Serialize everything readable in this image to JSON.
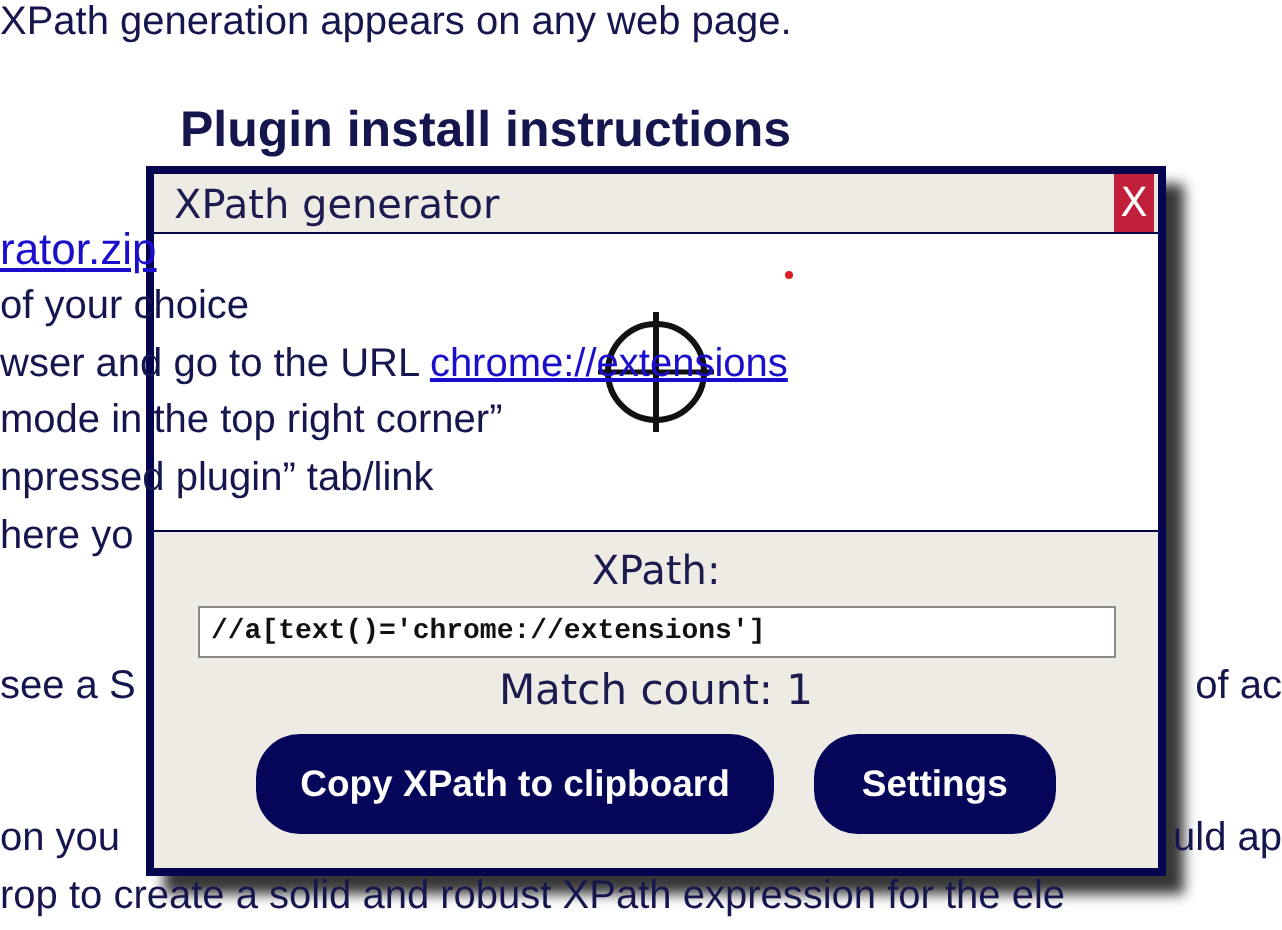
{
  "page": {
    "paragraphs": [
      {
        "kind": "text",
        "lines": [
          {
            "left": "XPath generation appears on any web page."
          }
        ]
      },
      {
        "kind": "heading",
        "lines": [
          {
            "left": "Plugin install instructions"
          }
        ]
      },
      {
        "kind": "text",
        "lines": [
          {
            "link": "rator.zip"
          },
          {
            "left": "of your choice"
          },
          {
            "left": "wser and go to the URL ",
            "link": "chrome://extensions"
          },
          {
            "left": "mode in the top right corner”"
          },
          {
            "left": "npressed plugin” tab/link"
          },
          {
            "left": "here yo"
          }
        ]
      },
      {
        "kind": "text",
        "lines": [
          {
            "left": "see a S",
            "right": "of ac"
          }
        ]
      },
      {
        "kind": "text",
        "lines": [
          {
            "left": "on you",
            "right": "uld ap"
          },
          {
            "left": "rop to create a solid and robust XPath expression for the ele"
          }
        ]
      }
    ]
  },
  "popup": {
    "title": "XPath generator",
    "close": "X",
    "xpath_label": "XPath:",
    "xpath_value": "//a[text()='chrome://extensions']",
    "match_count": "Match count: 1",
    "buttons": [
      "Copy XPath to clipboard",
      "Settings"
    ]
  }
}
